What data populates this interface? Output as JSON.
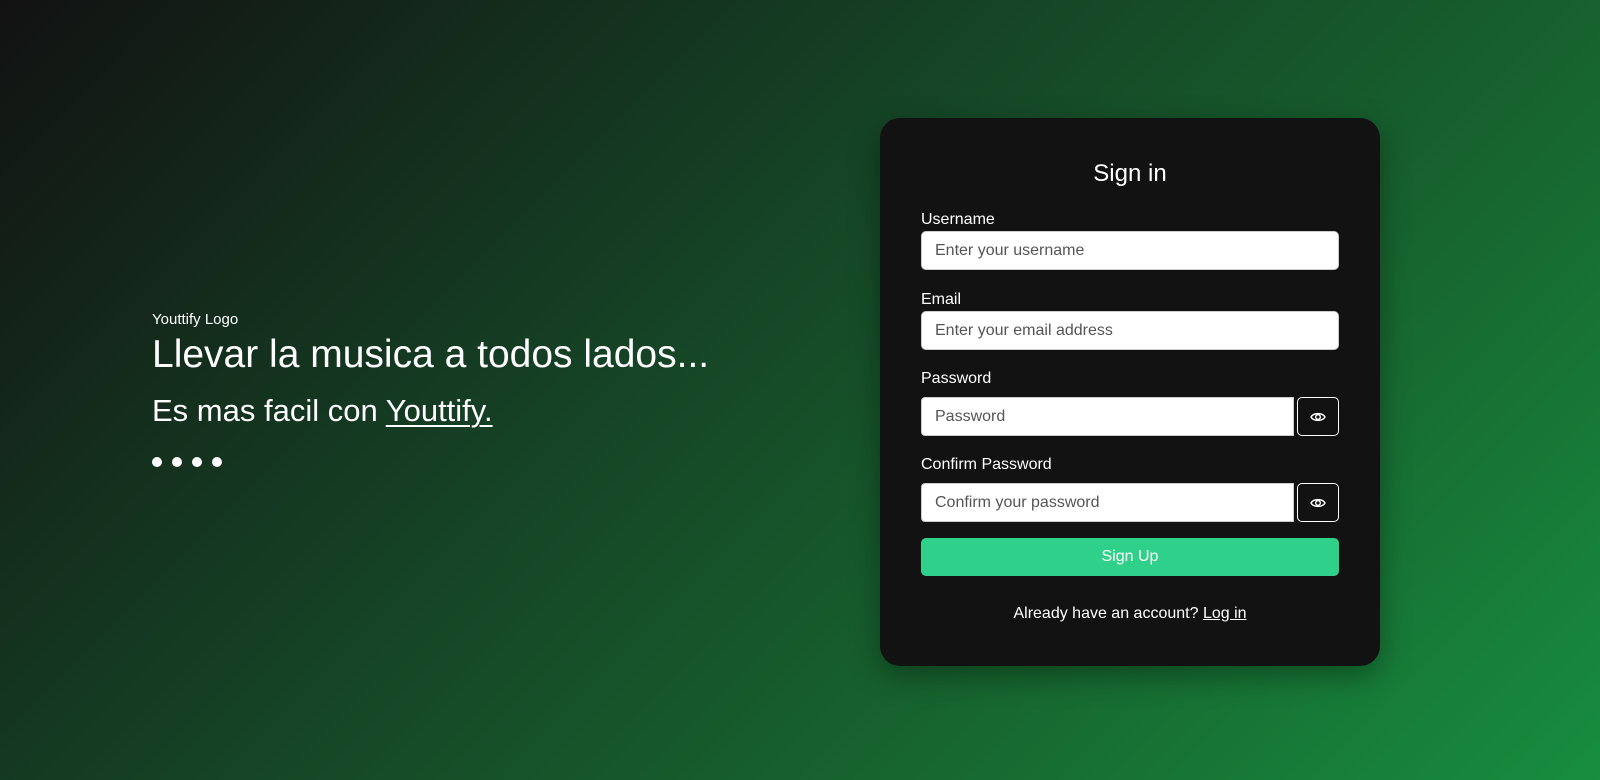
{
  "hero": {
    "logo_text": "Youttify Logo",
    "headline": "Llevar la musica a todos lados...",
    "subline_prefix": "Es mas facil con ",
    "brand_link": "Youttify.",
    "carousel_dots": 4
  },
  "signin_card": {
    "title": "Sign in",
    "username": {
      "label": "Username",
      "placeholder": "Enter your username",
      "value": ""
    },
    "email": {
      "label": "Email",
      "placeholder": "Enter your email address",
      "value": ""
    },
    "password": {
      "label": "Password",
      "placeholder": "Password",
      "value": "",
      "toggle_icon": "eye-icon"
    },
    "confirm_password": {
      "label": "Confirm Password",
      "placeholder": "Confirm your password",
      "value": "",
      "toggle_icon": "eye-icon"
    },
    "submit_label": "Sign Up",
    "footer_text": "Already have an account? ",
    "login_link": "Log in"
  },
  "colors": {
    "background_start": "#121212",
    "background_end": "#178d3f",
    "card_background": "#121212",
    "accent": "#2fd18a",
    "text": "#ffffff"
  }
}
